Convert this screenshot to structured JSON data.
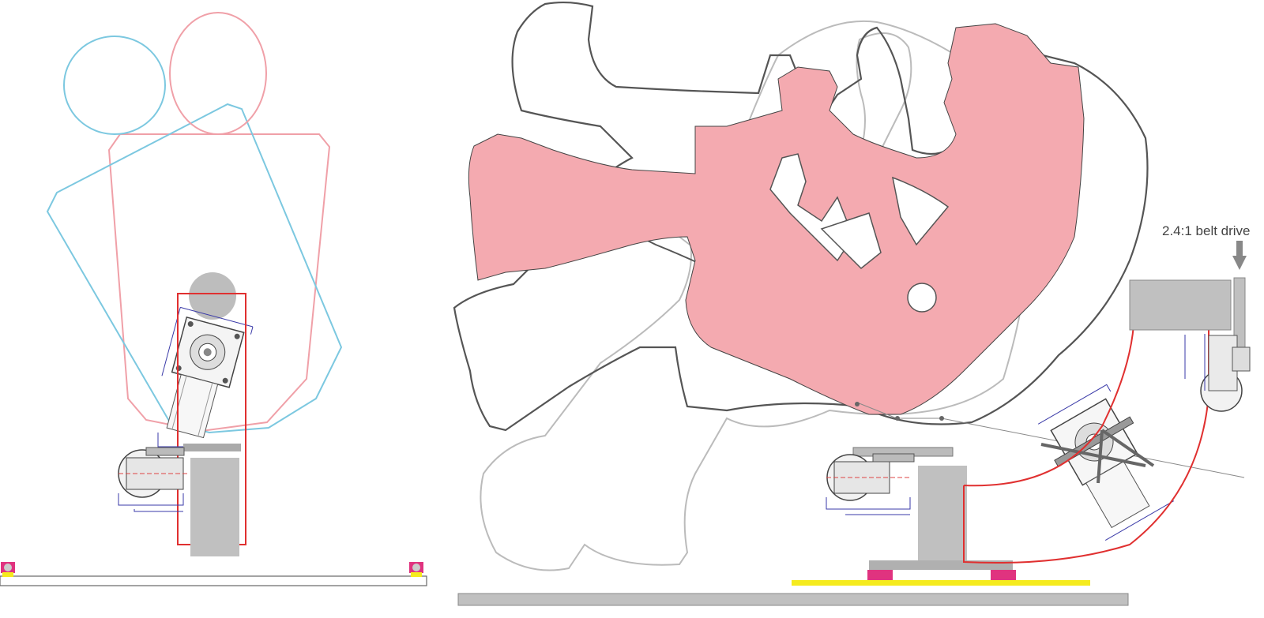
{
  "annotation": {
    "belt_drive_label": "2.4:1 belt drive"
  },
  "colors": {
    "figure_fill": "#f4aab0",
    "figure_outline_dark": "#555555",
    "figure_outline_light": "#bbbbbb",
    "front_head_blue": "#7cc8e0",
    "front_head_pink": "#f0a0a8",
    "frame_red": "#e03030",
    "column_gray": "#c0c0c0",
    "base_yellow": "#f5eb1e",
    "base_magenta": "#e0337f",
    "drawing_blue": "#3a3aa8"
  },
  "icons": [
    "down-arrow-icon",
    "gear-motor-icon",
    "pivot-knob-icon",
    "hole-icon"
  ]
}
